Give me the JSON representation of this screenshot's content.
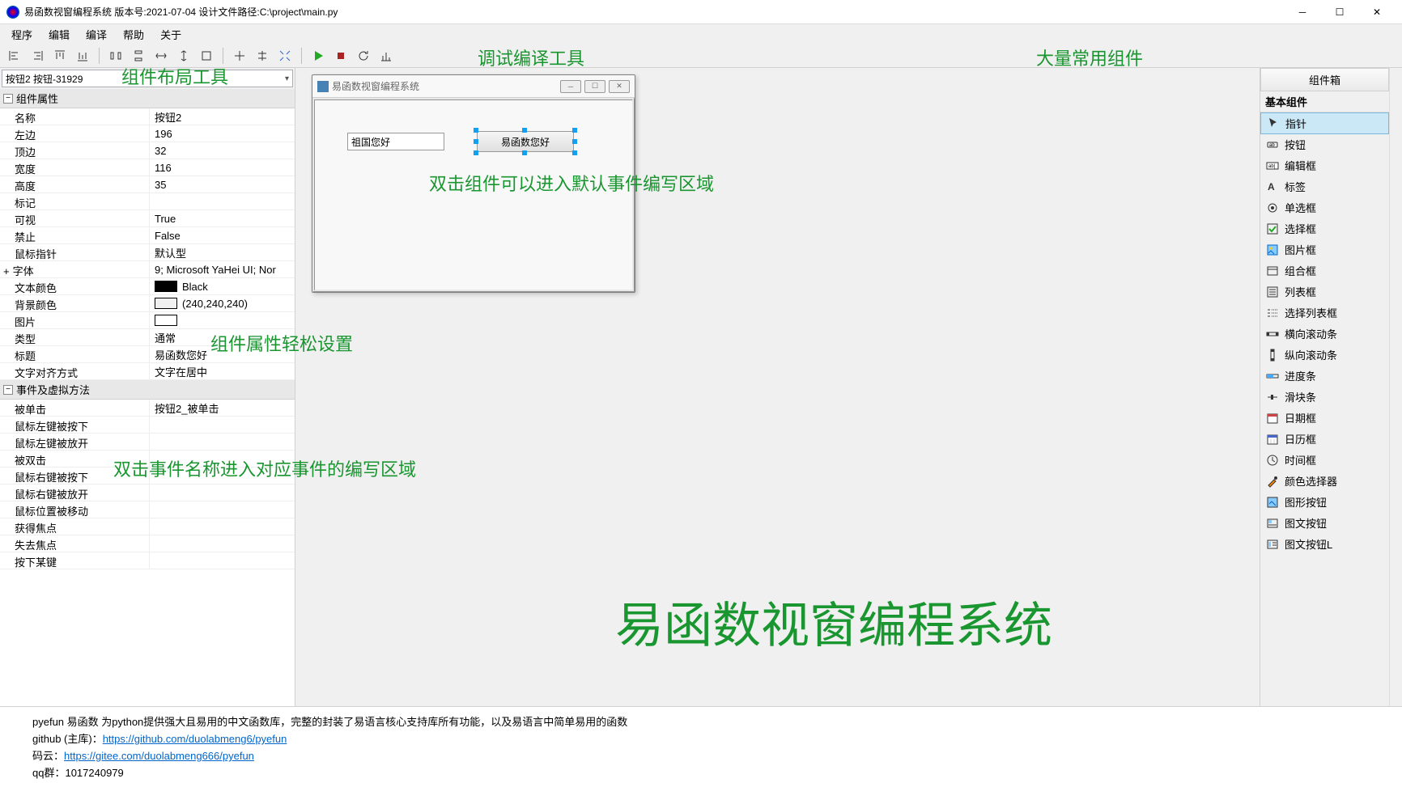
{
  "title": "易函数视窗编程系统 版本号:2021-07-04 设计文件路径:C:\\project\\main.py",
  "menu": [
    "程序",
    "编辑",
    "编译",
    "帮助",
    "关于"
  ],
  "combo_selected": "按钮2  按钮-31929",
  "prop_cat1": "组件属性",
  "props": [
    {
      "k": "名称",
      "v": "按钮2"
    },
    {
      "k": "左边",
      "v": "196"
    },
    {
      "k": "顶边",
      "v": "32"
    },
    {
      "k": "宽度",
      "v": "116"
    },
    {
      "k": "高度",
      "v": "35"
    },
    {
      "k": "标记",
      "v": ""
    },
    {
      "k": "可视",
      "v": "True"
    },
    {
      "k": "禁止",
      "v": "False"
    },
    {
      "k": "鼠标指针",
      "v": "默认型"
    },
    {
      "k": "字体",
      "v": "9; Microsoft YaHei UI; Nor",
      "expand": true
    },
    {
      "k": "文本颜色",
      "v": "Black",
      "color": "#000000"
    },
    {
      "k": "背景颜色",
      "v": "(240,240,240)",
      "color": "#f0f0f0"
    },
    {
      "k": "图片",
      "v": "",
      "color": "#ffffff"
    },
    {
      "k": "类型",
      "v": "通常"
    },
    {
      "k": "标题",
      "v": "易函数您好"
    },
    {
      "k": "文字对齐方式",
      "v": "文字在居中"
    }
  ],
  "prop_cat2": "事件及虚拟方法",
  "events": [
    {
      "k": "被单击",
      "v": "按钮2_被单击"
    },
    {
      "k": "鼠标左键被按下",
      "v": ""
    },
    {
      "k": "鼠标左键被放开",
      "v": ""
    },
    {
      "k": "被双击",
      "v": ""
    },
    {
      "k": "鼠标右键被按下",
      "v": ""
    },
    {
      "k": "鼠标右键被放开",
      "v": ""
    },
    {
      "k": "鼠标位置被移动",
      "v": ""
    },
    {
      "k": "获得焦点",
      "v": ""
    },
    {
      "k": "失去焦点",
      "v": ""
    },
    {
      "k": "按下某键",
      "v": ""
    }
  ],
  "design_title": "易函数视窗编程系统",
  "input_text": "祖国您好",
  "button_text": "易函数您好",
  "right_title": "组件箱",
  "right_cat": "基本组件",
  "components": [
    "指针",
    "按钮",
    "编辑框",
    "标签",
    "单选框",
    "选择框",
    "图片框",
    "组合框",
    "列表框",
    "选择列表框",
    "横向滚动条",
    "纵向滚动条",
    "进度条",
    "滑块条",
    "日期框",
    "日历框",
    "时间框",
    "颜色选择器",
    "图形按钮",
    "图文按钮",
    "图文按钮L"
  ],
  "bottom": {
    "l1": "pyefun 易函数 为python提供强大且易用的中文函数库，完整的封装了易语言核心支持库所有功能，以及易语言中简单易用的函数",
    "l2_pre": "github (主库)：",
    "l2_link": "https://github.com/duolabmeng6/pyefun",
    "l3_pre": "码云：",
    "l3_link": "https://gitee.com/duolabmeng666/pyefun",
    "l4": "qq群：1017240979"
  },
  "anno": {
    "layout": "组件布局工具",
    "debug": "调试编译工具",
    "right": "大量常用组件",
    "dbl": "双击组件可以进入默认事件编写区域",
    "propset": "组件属性轻松设置",
    "event": "双击事件名称进入对应事件的编写区域",
    "big": "易函数视窗编程系统"
  }
}
